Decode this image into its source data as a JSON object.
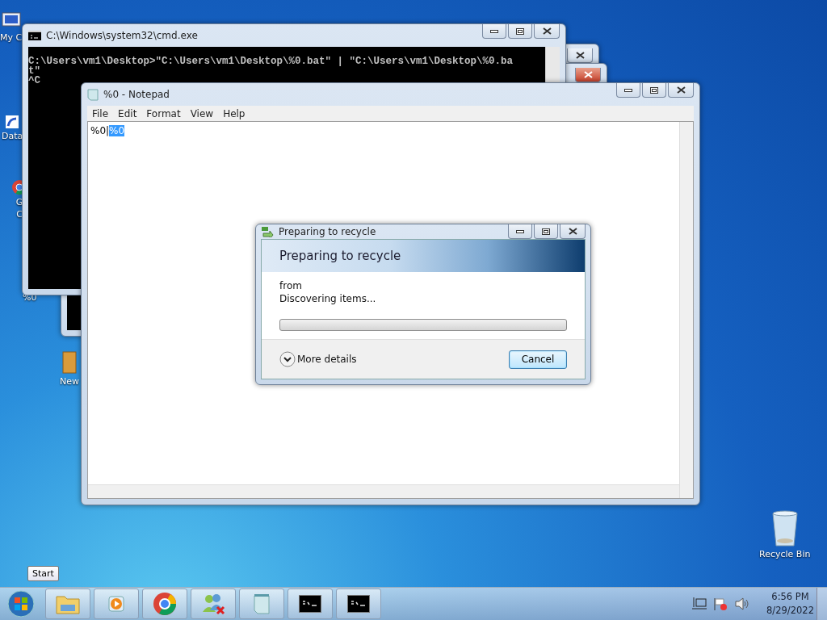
{
  "desktop_icons": [
    {
      "kind": "computer",
      "label": "My C"
    },
    {
      "kind": "shortcut",
      "label": "Data"
    },
    {
      "kind": "chrome",
      "label": "G\nC"
    },
    {
      "kind": "file",
      "label": "%0"
    },
    {
      "kind": "folder",
      "label": "New"
    },
    {
      "kind": "bin",
      "label": "Recycle Bin"
    }
  ],
  "cmd_window": {
    "title": "C:\\Windows\\system32\\cmd.exe",
    "lines": [
      "C:\\Users\\vm1\\Desktop>\"C:\\Users\\vm1\\Desktop\\%0.bat\" | \"C:\\Users\\vm1\\Desktop\\%0.ba",
      "t\"",
      "^C"
    ]
  },
  "notepad": {
    "title": "%0 - Notepad",
    "menu": [
      "File",
      "Edit",
      "Format",
      "View",
      "Help"
    ],
    "text": "%0|",
    "selected_text": "%0"
  },
  "recycle_dialog": {
    "title": "Preparing to recycle",
    "heading": "Preparing to recycle",
    "from": "from",
    "status": "Discovering items...",
    "progress": {
      "level": 0
    },
    "more_details": "More details",
    "cancel": "Cancel"
  },
  "tooltip": "Start",
  "taskbar": {
    "items": [
      {
        "kind": "explorer"
      },
      {
        "kind": "media"
      },
      {
        "kind": "chrome"
      },
      {
        "kind": "people"
      },
      {
        "kind": "notepad"
      },
      {
        "kind": "console"
      },
      {
        "kind": "console"
      }
    ],
    "time": "6:56 PM",
    "date": "8/29/2022"
  }
}
